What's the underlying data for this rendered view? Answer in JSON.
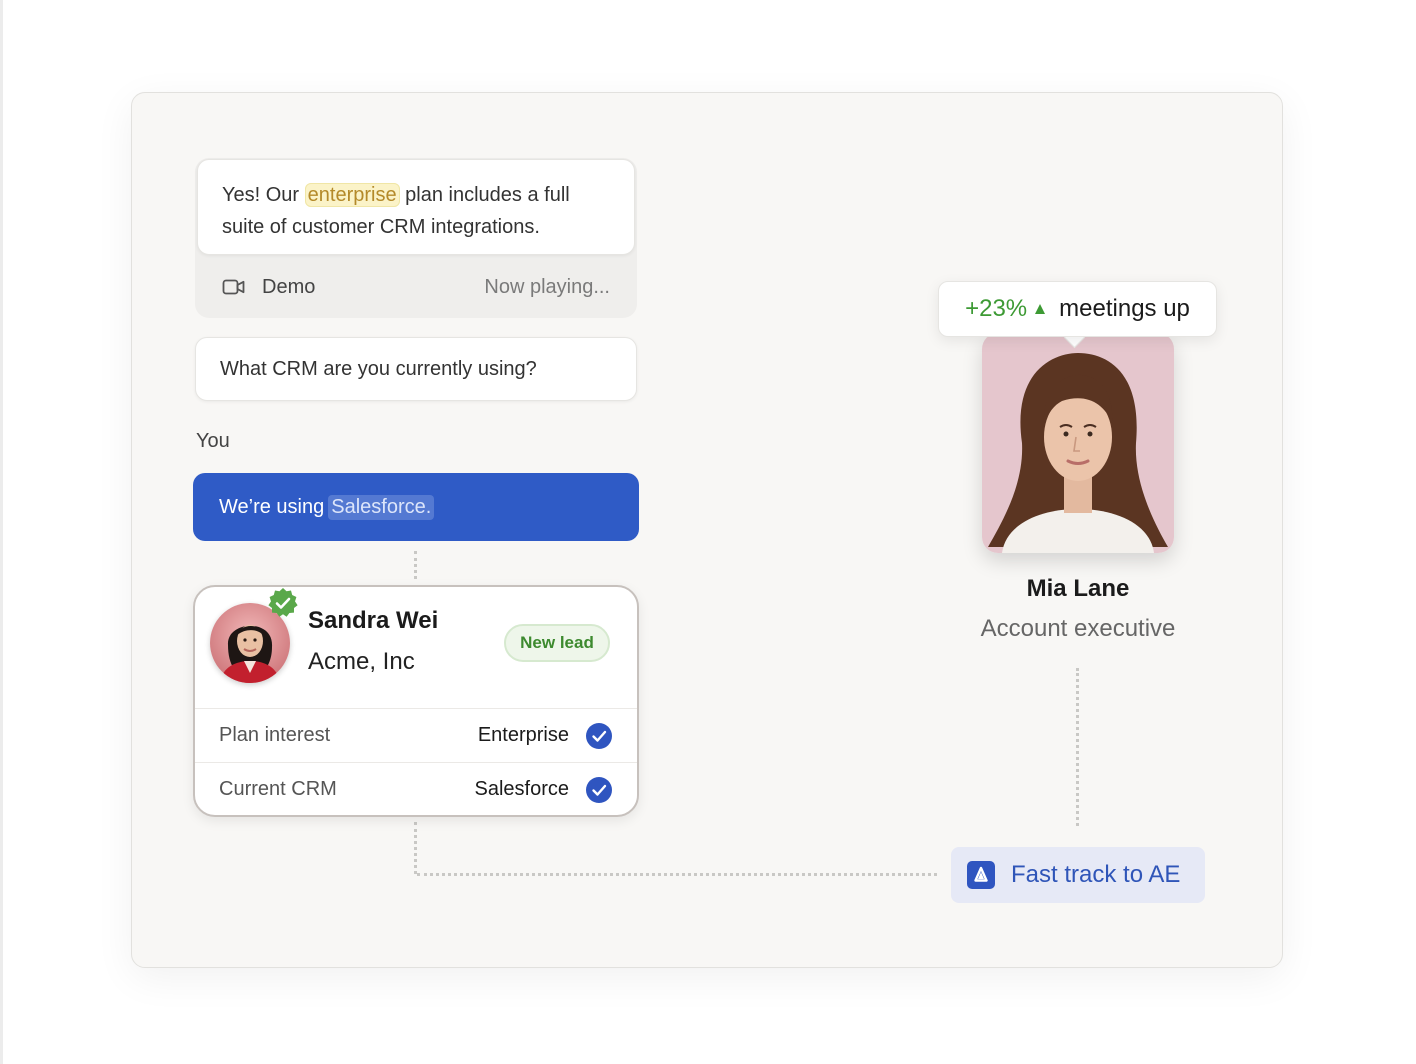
{
  "colors": {
    "accent_blue": "#2f5bc6",
    "highlight_yellow": "#fbf3c8",
    "success_green": "#3d9a34",
    "card_bg": "#f8f7f5"
  },
  "chat": {
    "bot_message": {
      "prefix": "Yes! Our",
      "highlight": "enterprise",
      "suffix": "plan includes a full suite of customer CRM integrations."
    },
    "demo": {
      "icon": "video-icon",
      "label": "Demo",
      "status": "Now playing..."
    },
    "question": "What CRM are you currently using?",
    "user_label": "You",
    "user_message": {
      "prefix": "We’re using",
      "highlight": "Salesforce."
    }
  },
  "lead": {
    "name": "Sandra Wei",
    "company": "Acme, Inc",
    "badge": "New lead",
    "verified_icon": "verified-badge-icon",
    "rows": [
      {
        "label": "Plan interest",
        "value": "Enterprise",
        "icon": "check-circle-icon"
      },
      {
        "label": "Current CRM",
        "value": "Salesforce",
        "icon": "check-circle-icon"
      }
    ]
  },
  "rep": {
    "stat_value": "+23%",
    "stat_icon": "arrow-up-icon",
    "stat_label": "meetings up",
    "name": "Mia Lane",
    "role": "Account executive"
  },
  "action": {
    "icon": "fast-track-icon",
    "label": "Fast track to AE"
  }
}
